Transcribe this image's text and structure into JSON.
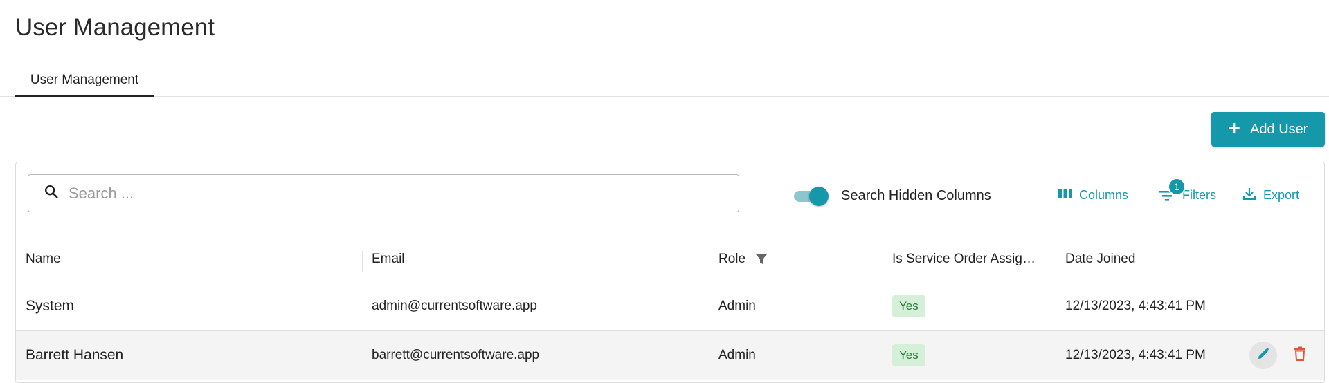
{
  "page": {
    "title": "User Management"
  },
  "tabs": [
    {
      "label": "User Management",
      "active": true
    }
  ],
  "actions": {
    "add_user_label": "Add User"
  },
  "toolbar": {
    "search_placeholder": "Search ...",
    "search_hidden_label": "Search Hidden Columns",
    "search_hidden_on": true,
    "columns_label": "Columns",
    "filters_label": "Filters",
    "filters_count": "1",
    "export_label": "Export"
  },
  "table": {
    "columns": [
      "Name",
      "Email",
      "Role",
      "Is Service Order Assig…",
      "Date Joined"
    ],
    "rows": [
      {
        "name": "System",
        "email": "admin@currentsoftware.app",
        "role": "Admin",
        "assignable": "Yes",
        "date_joined": "12/13/2023, 4:43:41 PM"
      },
      {
        "name": "Barrett Hansen",
        "email": "barrett@currentsoftware.app",
        "role": "Admin",
        "assignable": "Yes",
        "date_joined": "12/13/2023, 4:43:41 PM"
      }
    ]
  },
  "colors": {
    "accent": "#1598aa",
    "yes_bg": "#d6efd9",
    "yes_text": "#2d7a3a",
    "delete": "#e2553d"
  }
}
